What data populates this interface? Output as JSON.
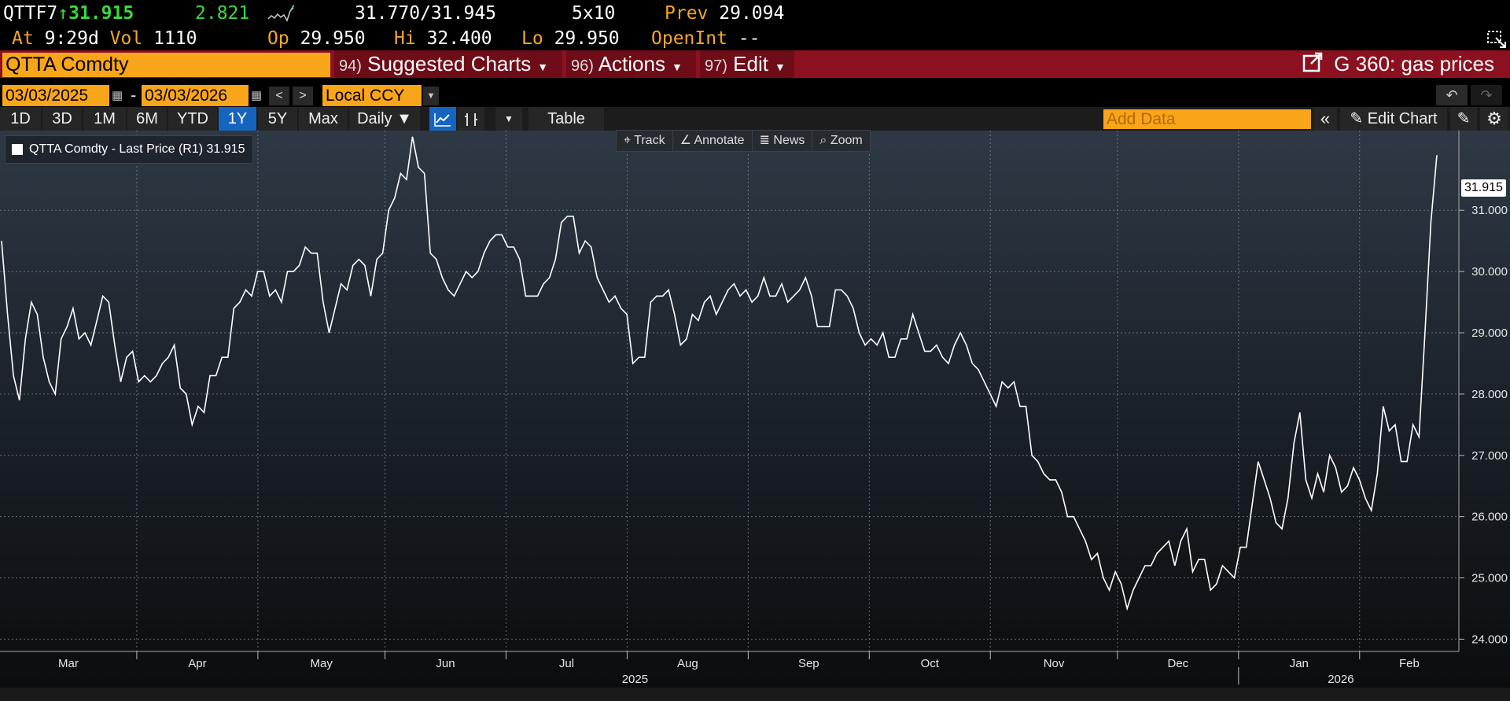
{
  "header": {
    "ticker": "QTTF7",
    "arrow": "↑",
    "last": "31.915",
    "change": "2.821",
    "bid_ask": "31.770/31.945",
    "size": "5x10",
    "prev_label": "Prev",
    "prev": "29.094",
    "at_label": "At",
    "time": "9:29d",
    "vol_label": "Vol",
    "vol": "1110",
    "op_label": "Op",
    "op": "29.950",
    "hi_label": "Hi",
    "hi": "32.400",
    "lo_label": "Lo",
    "lo": "29.950",
    "oi_label": "OpenInt",
    "oi": "--"
  },
  "command": {
    "security": "QTTA Comdty",
    "menus": [
      {
        "num": "94)",
        "label": "Suggested Charts"
      },
      {
        "num": "96)",
        "label": "Actions"
      },
      {
        "num": "97)",
        "label": "Edit"
      }
    ],
    "function": "G 360: gas prices"
  },
  "dates": {
    "start": "03/03/2025",
    "sep": "-",
    "end": "03/03/2026",
    "currency": "Local CCY"
  },
  "periods": [
    "1D",
    "3D",
    "1M",
    "6M",
    "YTD",
    "1Y",
    "5Y",
    "Max"
  ],
  "active_period": "1Y",
  "frequency": "Daily ▼",
  "table_label": "Table",
  "add_data_placeholder": "Add Data",
  "edit_chart_label": "Edit Chart",
  "tools": [
    "Track",
    "Annotate",
    "News",
    "Zoom"
  ],
  "legend": {
    "text": "QTTA Comdty - Last Price (R1) 31.915"
  },
  "last_label": "31.915",
  "colors": {
    "accent": "#f9a51a",
    "bar": "#8c1120",
    "up": "#3bd93b",
    "line": "#ffffff"
  },
  "chart_data": {
    "type": "line",
    "title": "",
    "xlabel": "",
    "ylabel": "",
    "ylim": [
      23.8,
      32.3
    ],
    "yticks": [
      "24.000",
      "25.000",
      "26.000",
      "27.000",
      "28.000",
      "29.000",
      "30.000",
      "31.000"
    ],
    "x_labels": [
      "Mar",
      "Apr",
      "May",
      "Jun",
      "Jul",
      "Aug",
      "Sep",
      "Oct",
      "Nov",
      "Dec",
      "Jan",
      "Feb"
    ],
    "year_labels": [
      "2025",
      "2026"
    ],
    "grid": true,
    "series": [
      {
        "values": [
          30.5,
          29.3,
          28.3,
          27.9,
          28.9,
          29.5,
          29.3,
          28.6,
          28.2,
          28.0,
          28.9,
          29.1,
          29.4,
          28.9,
          29.0,
          28.8,
          29.2,
          29.6,
          29.5,
          28.8,
          28.2,
          28.6,
          28.7,
          28.2,
          28.3,
          28.2,
          28.3,
          28.5,
          28.6,
          28.8,
          28.1,
          28.0,
          27.5,
          27.8,
          27.7,
          28.3,
          28.3,
          28.6,
          28.6,
          29.4,
          29.5,
          29.7,
          29.6,
          30.0,
          30.0,
          29.6,
          29.7,
          29.5,
          30.0,
          30.0,
          30.1,
          30.4,
          30.3,
          30.3,
          29.5,
          29.0,
          29.4,
          29.8,
          29.7,
          30.1,
          30.2,
          30.1,
          29.6,
          30.2,
          30.3,
          31.0,
          31.2,
          31.6,
          31.5,
          32.2,
          31.7,
          31.6,
          30.3,
          30.2,
          29.9,
          29.7,
          29.6,
          29.8,
          30.0,
          29.9,
          30.0,
          30.3,
          30.5,
          30.6,
          30.6,
          30.4,
          30.4,
          30.2,
          29.6,
          29.6,
          29.6,
          29.8,
          29.9,
          30.2,
          30.8,
          30.9,
          30.9,
          30.3,
          30.5,
          30.4,
          29.9,
          29.7,
          29.5,
          29.6,
          29.4,
          29.3,
          28.5,
          28.6,
          28.6,
          29.5,
          29.6,
          29.6,
          29.7,
          29.3,
          28.8,
          28.9,
          29.3,
          29.2,
          29.5,
          29.6,
          29.3,
          29.5,
          29.7,
          29.8,
          29.6,
          29.7,
          29.5,
          29.6,
          29.9,
          29.6,
          29.6,
          29.8,
          29.5,
          29.6,
          29.7,
          29.9,
          29.6,
          29.1,
          29.1,
          29.1,
          29.7,
          29.7,
          29.6,
          29.4,
          29.0,
          28.8,
          28.9,
          28.8,
          29.0,
          28.6,
          28.6,
          28.9,
          28.9,
          29.3,
          29.0,
          28.7,
          28.7,
          28.8,
          28.6,
          28.5,
          28.8,
          29.0,
          28.8,
          28.5,
          28.4,
          28.2,
          28.0,
          27.8,
          28.2,
          28.1,
          28.2,
          27.8,
          27.8,
          27.0,
          26.9,
          26.7,
          26.6,
          26.6,
          26.4,
          26.0,
          26.0,
          25.8,
          25.6,
          25.3,
          25.4,
          25.0,
          24.8,
          25.1,
          24.9,
          24.5,
          24.8,
          25.0,
          25.2,
          25.2,
          25.4,
          25.5,
          25.6,
          25.2,
          25.6,
          25.8,
          25.1,
          25.3,
          25.3,
          24.8,
          24.9,
          25.2,
          25.1,
          25.0,
          25.5,
          25.5,
          26.2,
          26.9,
          26.6,
          26.3,
          25.9,
          25.8,
          26.3,
          27.2,
          27.7,
          26.6,
          26.3,
          26.7,
          26.4,
          27.0,
          26.8,
          26.4,
          26.5,
          26.8,
          26.6,
          26.3,
          26.1,
          26.7,
          27.8,
          27.4,
          27.5,
          26.9,
          26.9,
          27.5,
          27.3,
          29.0,
          30.8,
          31.9
        ]
      }
    ]
  }
}
